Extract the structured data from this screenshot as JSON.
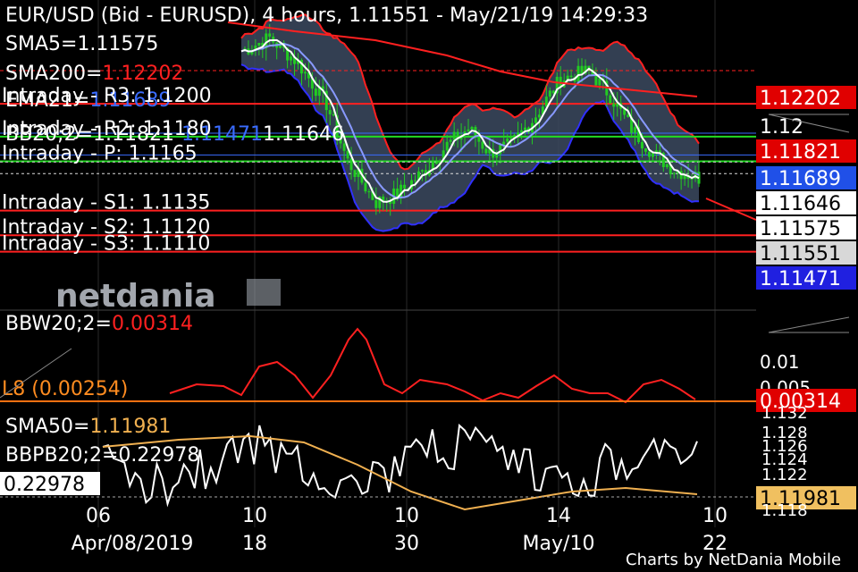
{
  "header": {
    "title": "EUR/USD (Bid - EURUSD),  4 hours, 1.11551 - May/21/19 14:29:33"
  },
  "indicators": {
    "sma5": {
      "label": "SMA5=",
      "value": "1.11575",
      "color": "#ffffff"
    },
    "sma200": {
      "label": "SMA200=",
      "value": "1.12202",
      "color": "#ff2020"
    },
    "ema21": {
      "label": "EMA21=",
      "value": "1.11689",
      "color": "#3a6cff"
    },
    "bb": {
      "label": "BB20;2=1.11821",
      "value2": "1.11471",
      "value3": "1.11646"
    }
  },
  "pivots": [
    {
      "label": "Intraday - R3: 1.1200",
      "price": 1.12,
      "color": "#ff2020"
    },
    {
      "label": "Intraday - R2: 1.1180",
      "price": 1.118,
      "color": "#22dd22"
    },
    {
      "label": "Intraday - P: 1.1165",
      "price": 1.1165,
      "color": "#22dd22"
    },
    {
      "label": "Intraday - S1: 1.1135",
      "price": 1.1135,
      "color": "#ff2020"
    },
    {
      "label": "Intraday - S2: 1.1120",
      "price": 1.112,
      "color": "#ff2020"
    },
    {
      "label": "Intraday - S3: 1.1110",
      "price": 1.111,
      "color": "#ff2020"
    }
  ],
  "price_tags": [
    {
      "text": "1.12202",
      "bg": "#e00000",
      "fg": "#ffffff"
    },
    {
      "text": "1.12",
      "bg": "",
      "fg": "#ffffff"
    },
    {
      "text": "1.11821",
      "bg": "#e00000",
      "fg": "#ffffff"
    },
    {
      "text": "1.11689",
      "bg": "#2050e8",
      "fg": "#ffffff"
    },
    {
      "text": "1.11646",
      "bg": "#ffffff",
      "fg": "#000000"
    },
    {
      "text": "1.11575",
      "bg": "#ffffff",
      "fg": "#000000"
    },
    {
      "text": "1.11551",
      "bg": "#d8d8d8",
      "fg": "#000000"
    },
    {
      "text": "1.11471",
      "bg": "#2020e0",
      "fg": "#ffffff"
    }
  ],
  "bbw_panel": {
    "label": "BBW20;2=",
    "value": "0.00314",
    "level_label": "L8 (0.00254)",
    "tick_label": "0.01",
    "tick_label2": "0.005",
    "tag": "0.00314"
  },
  "sma50_panel": {
    "label": "SMA50=",
    "value": "1.11981",
    "bbpb_label": "BBPB20;2=0.22978",
    "left_tag": "0.22978",
    "right_tag": "1.11981",
    "ticks": [
      "1.132",
      "1.128",
      "1.126",
      "1.124",
      "1.122",
      "1.118"
    ]
  },
  "x_axis": {
    "row1": [
      "06",
      "10",
      "10",
      "14",
      "10"
    ],
    "row2": [
      "Apr/08/2019",
      "18",
      "30",
      "May/10",
      "22"
    ]
  },
  "logo": {
    "text": "netdania"
  },
  "footer": {
    "credit": "Charts by NetDania Mobile"
  },
  "colors": {
    "background": "#000000",
    "band_fill": "#3c4a60",
    "band_upper": "#ff2020",
    "band_lower": "#3030ff",
    "candle": "#22cc22",
    "sma5": "#ffffff",
    "ema21": "#8899ff",
    "sma200": "#ff2020",
    "bbw": "#ff2020",
    "bbpb": "#ffffff",
    "sma50": "#f0b050",
    "level": "#ff7010"
  }
}
